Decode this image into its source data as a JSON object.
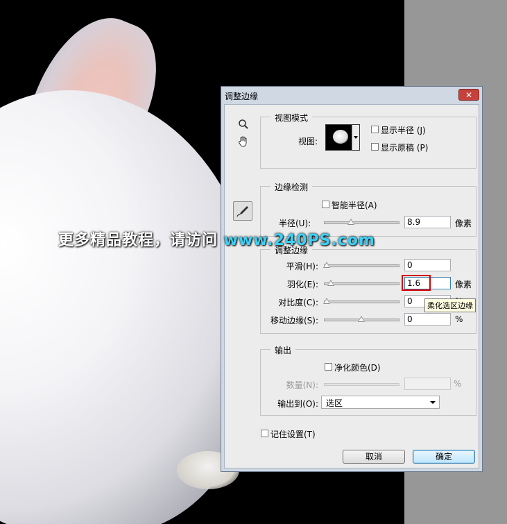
{
  "watermark": {
    "text": "更多精品教程，请访问 ",
    "site": "www.240PS.com"
  },
  "dialog": {
    "title": "调整边缘",
    "close_label": "✕",
    "view_mode": {
      "title": "视图模式",
      "view_label": "视图:",
      "show_radius": "显示半径 (J)",
      "show_original": "显示原稿 (P)"
    },
    "edge_detection": {
      "title": "边缘检测",
      "smart_radius": "智能半径(A)",
      "radius_label": "半径(U):",
      "radius_value": "8.9",
      "radius_unit": "像素",
      "radius_level": 0.35
    },
    "adjust_edge": {
      "title": "调整边缘",
      "smooth_label": "平滑(H):",
      "smooth_value": "0",
      "smooth_level": 0,
      "feather_label": "羽化(E):",
      "feather_value": "1.6",
      "feather_unit": "像素",
      "feather_level": 0.06,
      "contrast_label": "对比度(C):",
      "contrast_value": "0",
      "contrast_unit": "%",
      "contrast_level": 0,
      "shift_label": "移动边缘(S):",
      "shift_value": "0",
      "shift_unit": "%",
      "shift_level": 0.5,
      "tooltip": "柔化选区边缘"
    },
    "output": {
      "title": "输出",
      "decontaminate": "净化颜色(D)",
      "amount_label": "数量(N):",
      "amount_unit": "%",
      "output_to_label": "输出到(O):",
      "output_to_value": "选区"
    },
    "remember": "记住设置(T)",
    "cancel": "取消",
    "ok": "确定"
  }
}
